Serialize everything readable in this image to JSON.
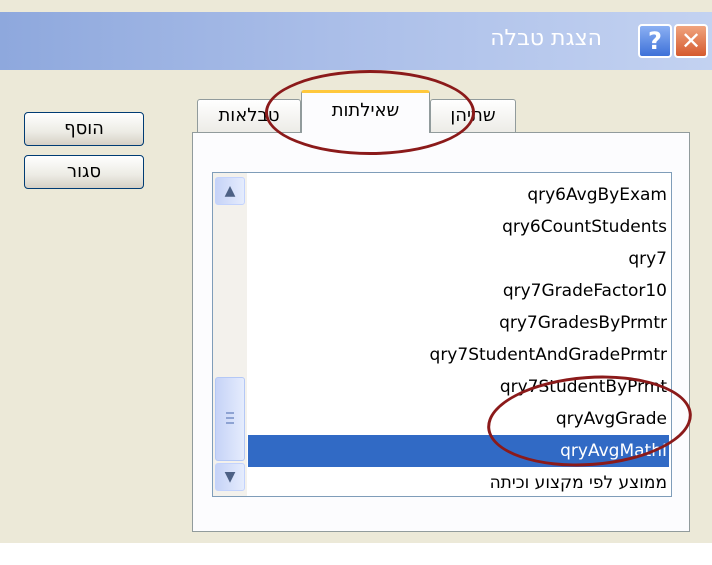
{
  "window": {
    "title": "הצגת טבלה",
    "help_label": "?",
    "close_label": "✕"
  },
  "buttons": {
    "add_label": "הוסף",
    "close_label": "סגור"
  },
  "tabs": [
    {
      "label": "טבלאות",
      "active": false
    },
    {
      "label": "שאילתות",
      "active": true
    },
    {
      "label": "שתיהן",
      "active": false
    }
  ],
  "list": {
    "items": [
      "qry6AvgByExam",
      "qry6CountStudents",
      "qry7",
      "qry7GradeFactor10",
      "qry7GradesByPrmtr",
      "qry7StudentAndGradePrmtr",
      "qry7StudentByPrmt",
      "qryAvgGrade",
      "qryAvgMathI",
      "ממוצע לפי מקצוע וכיתה"
    ],
    "selected": "qryAvgMathI"
  },
  "icons": {
    "scroll_up": "▲",
    "scroll_down": "▼"
  },
  "colors": {
    "selection": "#316ac5",
    "annotation": "#8b1a1a",
    "active_tab_accent": "#ffc83c"
  }
}
